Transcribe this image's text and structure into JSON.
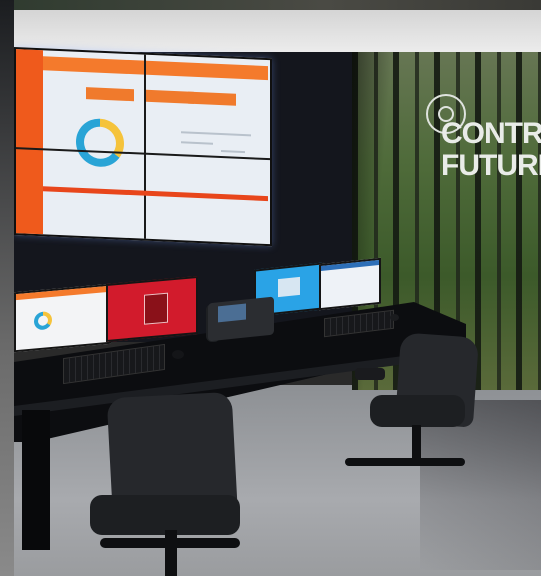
{
  "scene": {
    "description_labels": {
      "mural_text": [
        "CONTRO",
        "FUTURE"
      ]
    }
  },
  "colors": {
    "accent_orange": "#f47a2c",
    "video_wall_red": "#e8461b",
    "monitor_red": "#d21b2c",
    "monitor_blue": "#2aa3e6",
    "donut_blue": "#29a4d6",
    "donut_yellow": "#f5c33b"
  }
}
